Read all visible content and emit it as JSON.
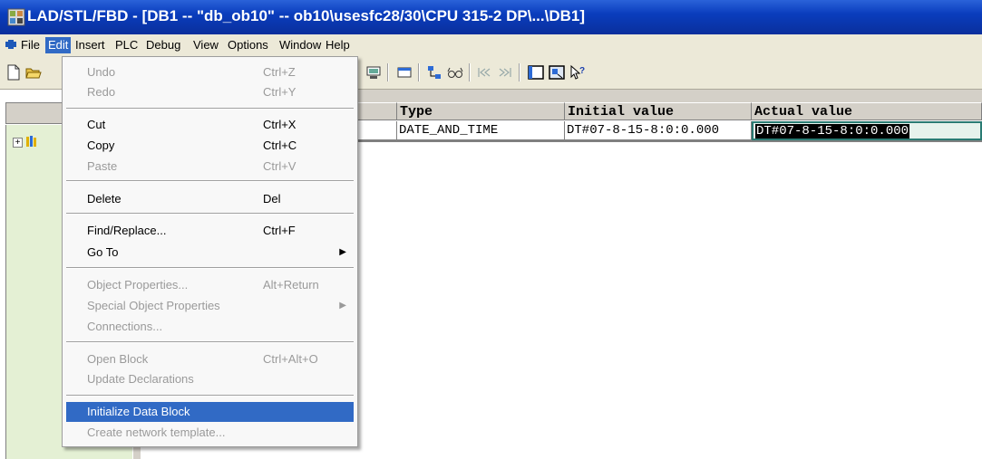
{
  "window": {
    "title": "LAD/STL/FBD  - [DB1 -- \"db_ob10\" -- ob10\\usesfc28/30\\CPU 315-2 DP\\...\\DB1]"
  },
  "menubar": {
    "items": [
      "File",
      "Edit",
      "Insert",
      "PLC",
      "Debug",
      "View",
      "Options",
      "Window",
      "Help"
    ]
  },
  "edit_menu": {
    "undo": {
      "label": "Undo",
      "shortcut": "Ctrl+Z"
    },
    "redo": {
      "label": "Redo",
      "shortcut": "Ctrl+Y"
    },
    "cut": {
      "label": "Cut",
      "shortcut": "Ctrl+X"
    },
    "copy": {
      "label": "Copy",
      "shortcut": "Ctrl+C"
    },
    "paste": {
      "label": "Paste",
      "shortcut": "Ctrl+V"
    },
    "delete": {
      "label": "Delete",
      "shortcut": "Del"
    },
    "find_replace": {
      "label": "Find/Replace...",
      "shortcut": "Ctrl+F"
    },
    "go_to": {
      "label": "Go To"
    },
    "object_properties": {
      "label": "Object Properties...",
      "shortcut": "Alt+Return"
    },
    "special_object_properties": {
      "label": "Special Object Properties"
    },
    "connections": {
      "label": "Connections..."
    },
    "open_block": {
      "label": "Open Block",
      "shortcut": "Ctrl+Alt+O"
    },
    "update_declarations": {
      "label": "Update Declarations"
    },
    "initialize_data_block": {
      "label": "Initialize Data Block"
    },
    "create_network_template": {
      "label": "Create network template..."
    }
  },
  "grid": {
    "headers": {
      "type": "Type",
      "initial_value": "Initial value",
      "actual_value": "Actual value"
    },
    "row": {
      "type": "DATE_AND_TIME",
      "initial_value": "DT#07-8-15-8:0:0.000",
      "actual_value": "DT#07-8-15-8:0:0.000"
    }
  },
  "icons": [
    "app-icon",
    "file-menu-icon",
    "new-file-icon",
    "open-folder-icon",
    "monitor-icon",
    "window-icon",
    "network-icon",
    "glasses-icon",
    "step-back-icon",
    "step-forward-icon",
    "panel-icon",
    "overview-icon",
    "help-pointer-icon"
  ],
  "colors": {
    "titlebar": "#0a3dbd",
    "menu_highlight": "#316ac5",
    "tree_background": "#e4f0d4",
    "selected_cell_border": "#2a7b73"
  }
}
